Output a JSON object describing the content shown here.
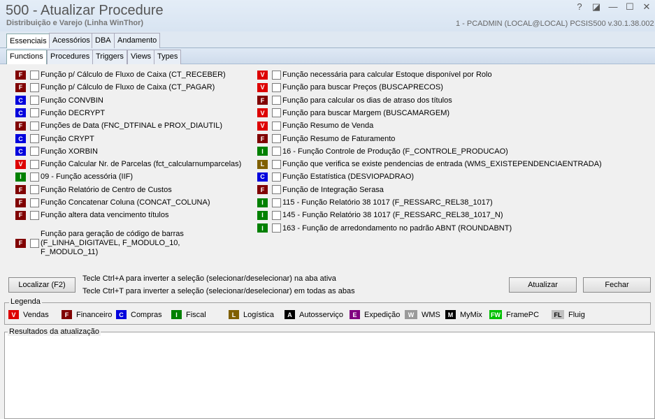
{
  "window": {
    "title": "500 - Atualizar Procedure",
    "subtitle": "Distribuição e Varejo (Linha WinThor)",
    "connection": "1 - PCADMIN (LOCAL@LOCAL)    PCSIS500  v.30.1.38.002"
  },
  "main_tabs": [
    "Essenciais",
    "Acessórios",
    "DBA",
    "Andamento"
  ],
  "sub_tabs": [
    "Functions",
    "Procedures",
    "Triggers",
    "Views",
    "Types"
  ],
  "colors": {
    "V": "#dd0000",
    "F": "#800000",
    "C": "#0000dd",
    "I": "#008000",
    "L": "#806000",
    "A": "#000000",
    "E": "#800080",
    "W": "#9a9a9a",
    "M": "#000000",
    "FW": "#00c000",
    "FL": "#c0c0c0"
  },
  "left_items": [
    {
      "badge": "F",
      "label": "Função p/ Cálculo de Fluxo de Caixa (CT_RECEBER)"
    },
    {
      "badge": "F",
      "label": "Função p/ Cálculo de Fluxo de Caixa (CT_PAGAR)"
    },
    {
      "badge": "C",
      "label": "Função CONVBIN"
    },
    {
      "badge": "C",
      "label": "Função DECRYPT"
    },
    {
      "badge": "F",
      "label": "Funções de Data (FNC_DTFINAL e PROX_DIAUTIL)"
    },
    {
      "badge": "C",
      "label": "Função CRYPT"
    },
    {
      "badge": "C",
      "label": "Função XORBIN"
    },
    {
      "badge": "V",
      "label": "Função Calcular Nr. de Parcelas (fct_calcularnumparcelas)"
    },
    {
      "badge": "I",
      "label": "09 - Função acessória (IIF)"
    },
    {
      "badge": "F",
      "label": "Função Relatório de Centro de Custos"
    },
    {
      "badge": "F",
      "label": "Função Concatenar Coluna (CONCAT_COLUNA)"
    },
    {
      "badge": "F",
      "label": "Função altera data vencimento títulos"
    },
    {
      "badge": "F",
      "label": "Função para geração de código de barras (F_LINHA_DIGITAVEL, F_MODULO_10, F_MODULO_11)"
    }
  ],
  "right_items": [
    {
      "badge": "V",
      "label": "Função necessária para calcular Estoque disponível por Rolo"
    },
    {
      "badge": "V",
      "label": "Função para buscar Preços (BUSCAPRECOS)"
    },
    {
      "badge": "F",
      "label": "Função para calcular os dias de atraso dos títulos"
    },
    {
      "badge": "V",
      "label": "Função para buscar Margem (BUSCAMARGEM)"
    },
    {
      "badge": "V",
      "label": "Função Resumo de Venda"
    },
    {
      "badge": "F",
      "label": "Função Resumo de Faturamento"
    },
    {
      "badge": "I",
      "label": "16 - Função Controle de Produção (F_CONTROLE_PRODUCAO)"
    },
    {
      "badge": "L",
      "label": "Função que verifica se existe pendencias de entrada (WMS_EXISTEPENDENCIAENTRADA)"
    },
    {
      "badge": "C",
      "label": "Função Estatística (DESVIOPADRAO)"
    },
    {
      "badge": "F",
      "label": "Função de Integração Serasa"
    },
    {
      "badge": "I",
      "label": "115 - Função Relatório 38 1017 (F_RESSARC_REL38_1017)"
    },
    {
      "badge": "I",
      "label": "145 - Função Relatório 38 1017 (F_RESSARC_REL38_1017_N)"
    },
    {
      "badge": "I",
      "label": "163 - Função de arredondamento no padrão ABNT (ROUNDABNT)"
    }
  ],
  "buttons": {
    "localizar": "Localizar (F2)",
    "atualizar": "Atualizar",
    "fechar": "Fechar"
  },
  "hints": [
    "Tecle Ctrl+A para inverter a seleção (selecionar/deselecionar) na aba ativa",
    "Tecle Ctrl+T para inverter a seleção (selecionar/deselecionar) em todas as abas"
  ],
  "legend": {
    "title": "Legenda",
    "items": [
      {
        "badge": "V",
        "label": "Vendas"
      },
      {
        "badge": "F",
        "label": "Financeiro"
      },
      {
        "badge": "C",
        "label": "Compras"
      },
      {
        "badge": "I",
        "label": "Fiscal"
      },
      {
        "badge": "L",
        "label": "Logística"
      },
      {
        "badge": "A",
        "label": "Autosserviço"
      },
      {
        "badge": "E",
        "label": "Expedição"
      },
      {
        "badge": "W",
        "label": "WMS"
      },
      {
        "badge": "M",
        "label": "MyMix"
      },
      {
        "badge": "FW",
        "label": "FramePC"
      },
      {
        "badge": "FL",
        "label": "Fluig"
      }
    ]
  },
  "results": {
    "title": "Resultados da atualização"
  }
}
